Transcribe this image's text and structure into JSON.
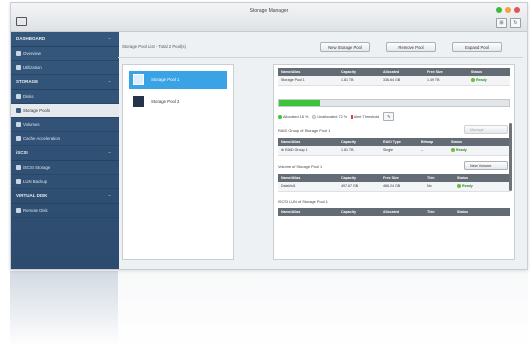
{
  "window": {
    "title": "Storage Manager"
  },
  "window_controls": {
    "colors": [
      "#3dbb3d",
      "#f2a33c",
      "#e45454"
    ]
  },
  "toolbar_buttons": [
    "⊞",
    "↻"
  ],
  "sidebar": {
    "sections": [
      {
        "label": "DASHBOARD",
        "items": [
          {
            "label": "Overview"
          },
          {
            "label": "Utilization"
          }
        ]
      },
      {
        "label": "STORAGE",
        "items": [
          {
            "label": "Disks"
          },
          {
            "label": "Storage Pools"
          },
          {
            "label": "Volumes"
          },
          {
            "label": "Cache Acceleration"
          }
        ]
      },
      {
        "label": "iSCSI",
        "items": [
          {
            "label": "iSCSI Storage"
          },
          {
            "label": "LUN Backup"
          }
        ]
      },
      {
        "label": "VIRTUAL DISK",
        "items": [
          {
            "label": "Remote Disk"
          }
        ]
      }
    ],
    "active_item": "Storage Pools",
    "accent": "#2f4f73"
  },
  "header": {
    "breadcrumb": "Storage Pool List - Total 2 Pool(s)",
    "buttons": {
      "new": "New Storage Pool",
      "remove": "Remove Pool",
      "expand": "Expand Pool"
    }
  },
  "pools": [
    {
      "name": "Storage Pool 1",
      "selected": true
    },
    {
      "name": "Storage Pool 2",
      "selected": false
    }
  ],
  "pool_table": {
    "headers": [
      "Name/Alias",
      "Capacity",
      "Allocated",
      "Free Size",
      "Status"
    ],
    "rows": [
      {
        "name": "Storage Pool 1",
        "capacity": "1.81 TB",
        "allocated": "336.64 GB",
        "free": "1.49 TB",
        "status": "Ready"
      }
    ]
  },
  "usage": {
    "allocated_fraction": 0.18,
    "legend": {
      "allocated": "Allocated 18 %",
      "unallocated": "Unallocated 72 %",
      "threshold": "Alert Threshold"
    },
    "colors": {
      "allocated": "#3cc43c",
      "unallocated": "#e3e6e9",
      "threshold": "#e23b3b"
    }
  },
  "raid": {
    "title": "RAID Group of Storage Pool 1",
    "manage_label": "Manage",
    "headers": [
      "Name/Alias",
      "Capacity",
      "RAID Type",
      "Bitmap",
      "Status"
    ],
    "rows": [
      {
        "name": "RAID Group 1",
        "capacity": "1.81 TB",
        "type": "Single",
        "bitmap": "--",
        "status": "Ready"
      }
    ]
  },
  "volumes": {
    "title": "Volume of Storage Pool 1",
    "new_label": "New Volume",
    "headers": [
      "Name/Alias",
      "Capacity",
      "Free Size",
      "Thin",
      "Status"
    ],
    "rows": [
      {
        "name": "DataVol1",
        "capacity": "497.67 GB",
        "free": "486.24 GB",
        "thin": "No",
        "status": "Ready"
      }
    ]
  },
  "luns": {
    "title": "iSCSI LUN of Storage Pool 1",
    "headers": [
      "Name/Alias",
      "Capacity",
      "Allocated",
      "Thin",
      "Status"
    ]
  }
}
